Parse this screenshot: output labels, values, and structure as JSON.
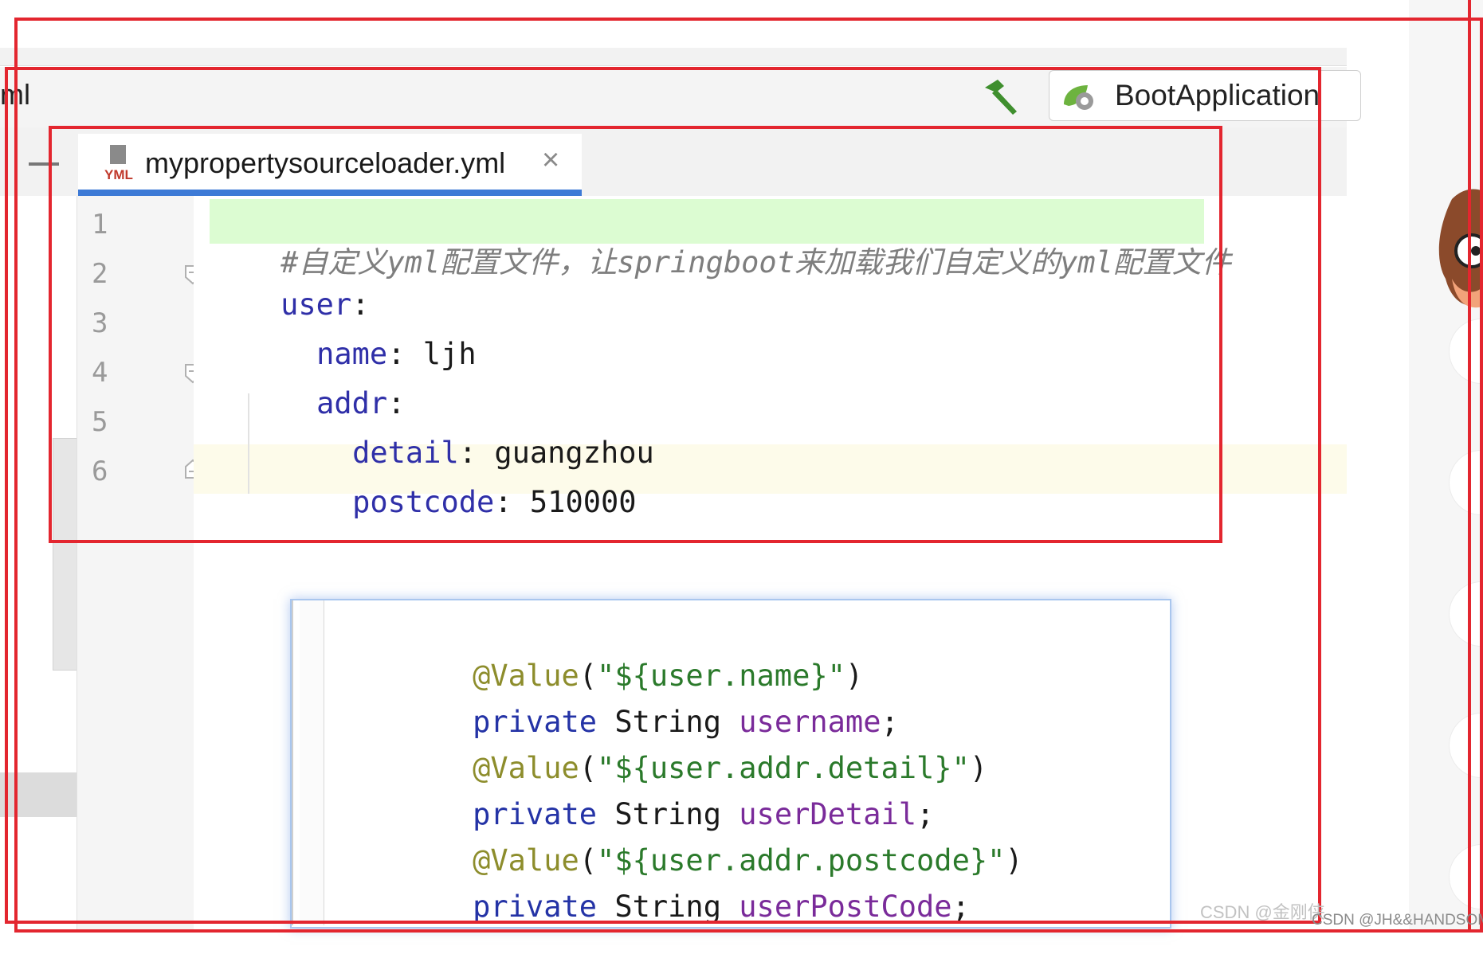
{
  "toolbar": {
    "file_fragment": "ml",
    "run_config": "BootApplication"
  },
  "tab": {
    "file_icon_text": "YML",
    "label": "mypropertysourceloader.yml",
    "close": "×"
  },
  "editor": {
    "line_numbers": [
      "1",
      "2",
      "3",
      "4",
      "5",
      "6"
    ],
    "lines": [
      {
        "comment": "#自定义yml配置文件，让springboot来加载我们自定义的yml配置文件"
      },
      {
        "key": "user",
        "sep": ":",
        "value": ""
      },
      {
        "key": "name",
        "sep": ": ",
        "value": "ljh"
      },
      {
        "key": "addr",
        "sep": ":",
        "value": ""
      },
      {
        "key": "detail",
        "sep": ": ",
        "value": "guangzhou"
      },
      {
        "key": "postcode",
        "sep": ": ",
        "value": "510000"
      }
    ]
  },
  "snippet": {
    "lines": [
      {
        "annotation": "@Value",
        "open": "(",
        "string": "\"${user.name}\"",
        "close": ")"
      },
      {
        "keyword": "private",
        "type": "String",
        "field": "username",
        "end": ";"
      },
      {
        "annotation": "@Value",
        "open": "(",
        "string": "\"${user.addr.detail}\"",
        "close": ")"
      },
      {
        "keyword": "private",
        "type": "String",
        "field": "userDetail",
        "end": ";"
      },
      {
        "annotation": "@Value",
        "open": "(",
        "string": "\"${user.addr.postcode}\"",
        "close": ")"
      },
      {
        "keyword": "private",
        "type": "String",
        "field": "userPostCode",
        "end": ";"
      }
    ]
  },
  "watermarks": {
    "faded": "CSDN @金刚侠",
    "credit": "CSDN @JH&&HANDSOME"
  },
  "colors": {
    "annotation_box": "#e3262f",
    "yaml_key": "#2f2fa8",
    "tab_underline": "#3d7ad6",
    "comment_highlight": "#dcfcd2",
    "current_line": "#fdfbea"
  }
}
